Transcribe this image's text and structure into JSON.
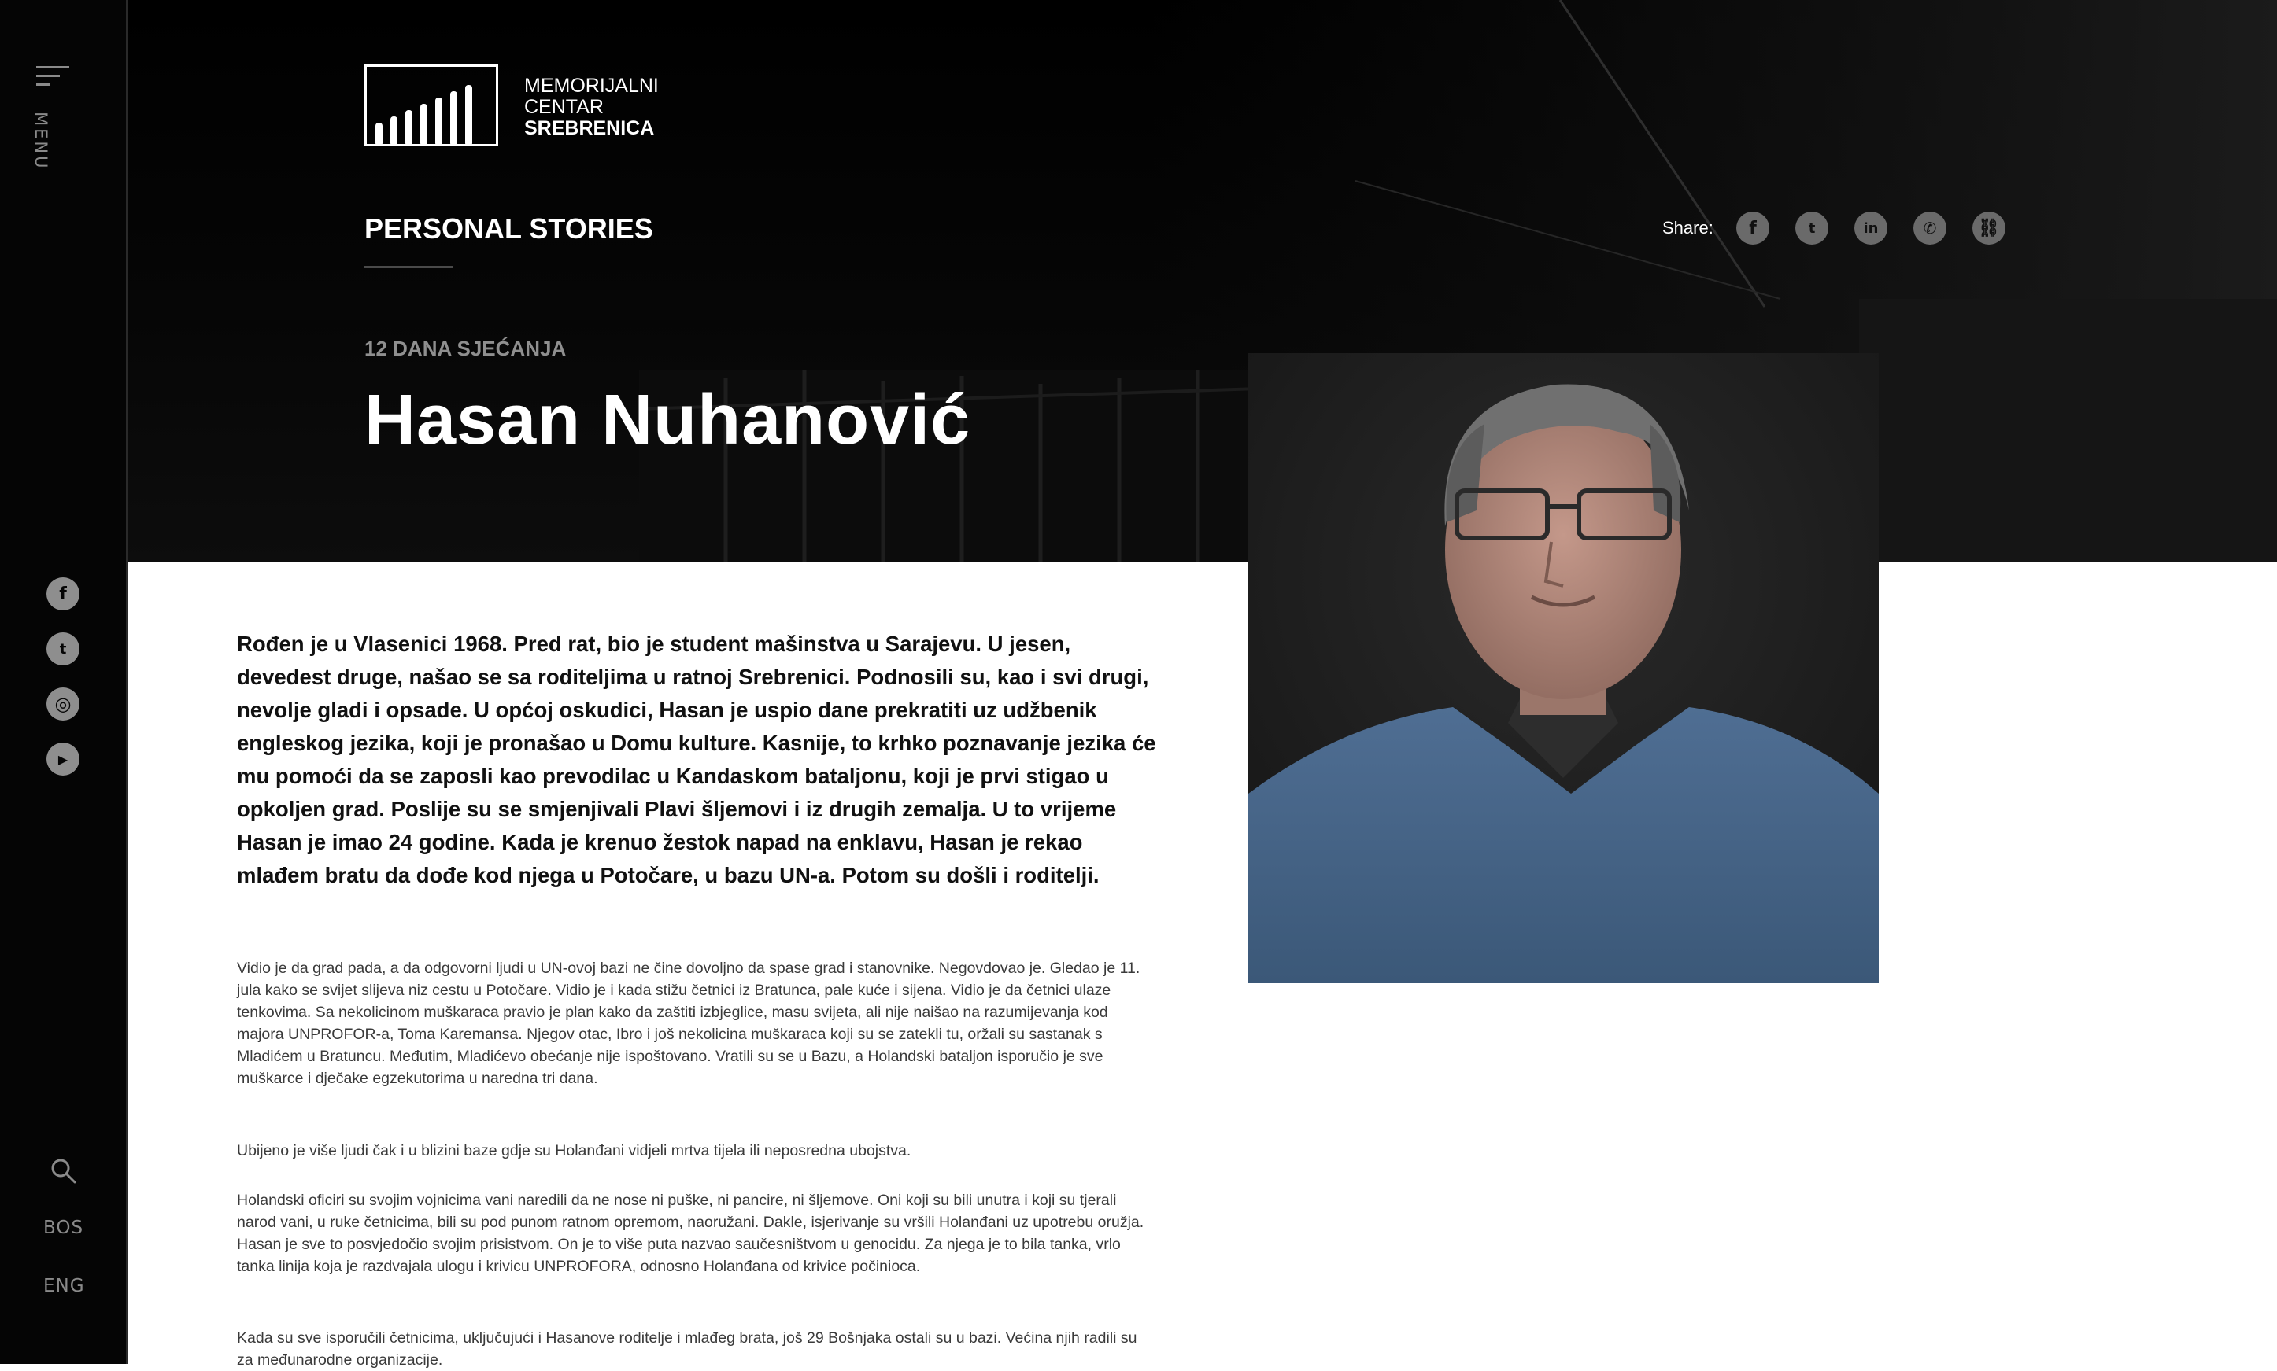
{
  "sidebar": {
    "menu_label": "MENU",
    "social": [
      {
        "icon": "facebook-icon",
        "glyph": "f"
      },
      {
        "icon": "twitter-icon",
        "glyph": "t"
      },
      {
        "icon": "instagram-icon",
        "glyph": "◎"
      },
      {
        "icon": "youtube-icon",
        "glyph": "▶"
      }
    ],
    "languages": [
      "BOS",
      "ENG"
    ]
  },
  "header": {
    "logo_lines": [
      "MEMORIJALNI",
      "CENTAR",
      "SREBRENICA"
    ],
    "section_title": "PERSONAL STORIES",
    "share_label": "Share:",
    "share_icons": [
      "facebook-icon",
      "twitter-icon",
      "linkedin-icon",
      "viber-icon",
      "link-icon"
    ]
  },
  "article": {
    "kicker": "12 DANA SJEĆANJA",
    "name": "Hasan Nuhanović",
    "lead": "Rođen je u Vlasenici 1968. Pred rat, bio je student mašinstva u Sarajevu. U jesen, devedest druge, našao se sa roditeljima u ratnoj Srebrenici. Podnosili su, kao i svi drugi, nevolje gladi i opsade. U općoj oskudici, Hasan je uspio dane prekratiti uz udžbenik engleskog jezika, koji je pronašao u Domu kulture. Kasnije, to krhko poznavanje jezika će mu pomoći da se zaposli kao prevodilac u Kandaskom bataljonu, koji je prvi stigao u opkoljen grad. Poslije su se smjenjivali Plavi šljemovi i iz drugih zemalja. U to vrijeme Hasan je imao 24 godine. Kada je krenuo žestok napad na enklavu, Hasan je rekao mlađem bratu da dođe kod njega u Potočare, u bazu UN-a. Potom su došli i roditelji.",
    "paragraphs": [
      "Vidio je da grad pada, a da odgovorni ljudi u UN-ovoj bazi ne čine dovoljno da spase grad i stanovnike. Negovdovao je. Gledao je 11. jula kako se svijet slijeva niz cestu u Potočare. Vidio je i kada stižu četnici iz Bratunca, pale kuće i sijena. Vidio je da četnici ulaze tenkovima. Sa nekolicinom muškaraca pravio je plan kako da zaštiti izbjeglice, masu svijeta, ali nije naišao na razumijevanja kod majora UNPROFOR-a, Toma Karemansa. Njegov otac, Ibro i još nekolicina muškaraca koji su se zatekli tu, oržali su sastanak s Mladićem u Bratuncu. Međutim, Mladićevo obećanje nije ispoštovano. Vratili su se u Bazu, a Holandski bataljon isporučio je sve muškarce i dječake egzekutorima u naredna tri dana.",
      "Ubijeno je više ljudi čak i u blizini baze gdje su Holanđani vidjeli mrtva tijela ili neposredna ubojstva.",
      "Holandski oficiri su svojim vojnicima vani naredili da ne nose ni puške, ni pancire, ni šljemove. Oni koji su bili unutra i koji su tjerali narod vani, u ruke četnicima, bili su pod punom ratnom opremom, naoružani. Dakle, isjerivanje su vršili Holanđani uz upotrebu oružja. Hasan je sve to posvjedočio svojim prisistvom. On je to više puta nazvao saučesništvom u genocidu. Za njega je to bila tanka, vrlo tanka linija koja je razdvajala ulogu i krivicu UNPROFORA, odnosno Holanđana od krivice počinioca.",
      "Kada su sve isporučili četnicima, uključujući i Hasanove roditelje i mlađeg brata, još 29 Bošnjaka ostali su u bazi. Većina njih radili su za međunarodne organizacije."
    ]
  },
  "colors": {
    "sidebar_bg": "#050505",
    "hero_bg": "#000000",
    "icon_gray": "#8e8e8e",
    "text_dark": "#111111",
    "text_body": "#3a3a3a",
    "kicker_gray": "#8f8f8f"
  }
}
